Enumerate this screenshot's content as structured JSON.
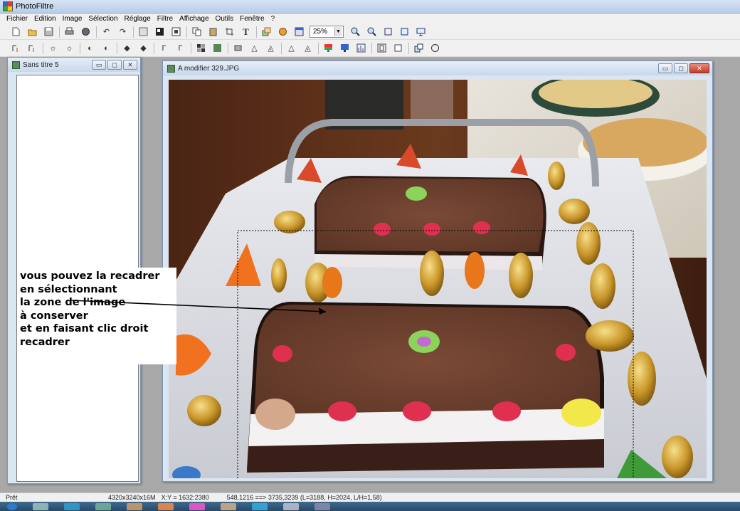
{
  "app": {
    "title": "PhotoFiltre",
    "menu": [
      "Fichier",
      "Edition",
      "Image",
      "Sélection",
      "Réglage",
      "Filtre",
      "Affichage",
      "Outils",
      "Fenêtre",
      "?"
    ]
  },
  "toolbar": {
    "zoom_value": "25%"
  },
  "windows": {
    "small": {
      "title": "Sans titre 5"
    },
    "main": {
      "title": "A modifier 329.JPG"
    }
  },
  "annotation": {
    "lines": [
      "vous pouvez la recadrer",
      "en sélectionnant",
      "la zone de l'image",
      "à conserver",
      "et en faisant clic droit",
      "recadrer"
    ]
  },
  "status": {
    "state": "Prêt",
    "image_size": "4320x3240x16M",
    "cursor": "X:Y = 1632:2380",
    "selection": "548,1216 ==> 3735,3239 (L=3188, H=2024, L/H=1,58)"
  },
  "colors": {
    "chrome": "#f0f0f0",
    "mdi_background": "#a8a8a8",
    "title_gradient_top": "#d6e3f3",
    "close_button": "#c13d26"
  }
}
